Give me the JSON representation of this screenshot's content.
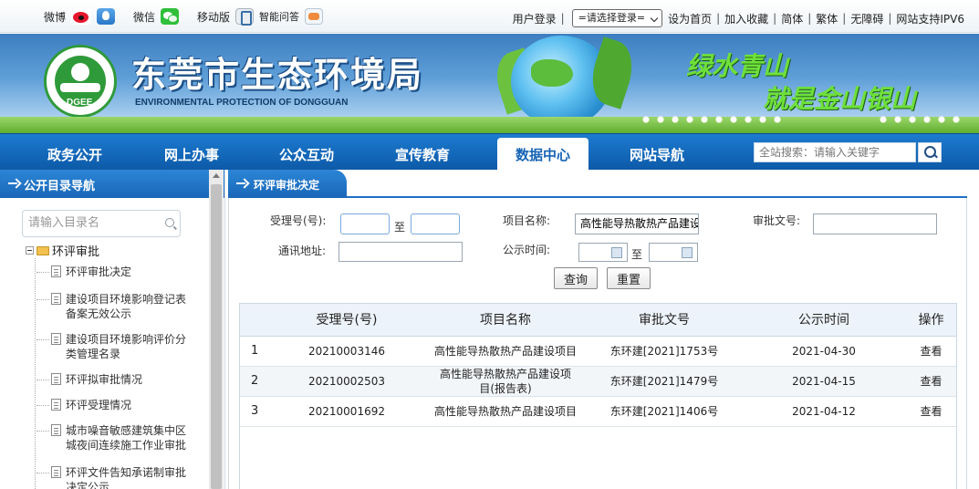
{
  "topbar": {
    "weibo_label": "微博",
    "wechat_label": "微信",
    "mobile_label": "移动版",
    "qa_label": "智能问答",
    "user_login": "用户登录",
    "login_select": "=请选择登录=",
    "links": [
      "设为首页",
      "加入收藏",
      "简体",
      "繁体",
      "无障碍",
      "网站支持IPV6"
    ]
  },
  "banner": {
    "logo_text": "DGEE",
    "title": "东莞市生态环境局",
    "subtitle": "ENVIRONMENTAL PROTECTION OF DONGGUAN",
    "slogan_line1": "绿水青山",
    "slogan_line2": "就是金山银山"
  },
  "nav": {
    "items": [
      "政务公开",
      "网上办事",
      "公众互动",
      "宣传教育",
      "数据中心",
      "网站导航"
    ],
    "active": "数据中心",
    "search_placeholder": "全站搜索：请输入关键字"
  },
  "sidebar": {
    "header": "公开目录导航",
    "filter_placeholder": "请输入目录名",
    "root": "环评审批",
    "items": [
      "环评审批决定",
      "建设项目环境影响登记表备案无效公示",
      "建设项目环境影响评价分类管理名录",
      "环评拟审批情况",
      "环评受理情况",
      "城市噪音敏感建筑集中区城夜间连续施工作业审批",
      "环评文件告知承诺制审批决定公示"
    ]
  },
  "main": {
    "tab": "环评审批决定",
    "form": {
      "accept_no_label": "受理号(号):",
      "to_label": "至",
      "project_label": "项目名称:",
      "project_value": "高性能导热散热产品建设项目",
      "approval_no_label": "审批文号:",
      "address_label": "通讯地址:",
      "publish_time_label": "公示时间:",
      "query_button": "查询",
      "reset_button": "重置"
    },
    "table": {
      "headers": [
        "",
        "受理号(号)",
        "项目名称",
        "审批文号",
        "公示时间",
        "操作"
      ],
      "rows": [
        {
          "idx": "1",
          "accept_no": "20210003146",
          "project": "高性能导热散热产品建设项目",
          "approval_no": "东环建[2021]1753号",
          "date": "2021-04-30",
          "op": "查看"
        },
        {
          "idx": "2",
          "accept_no": "20210002503",
          "project": "高性能导热散热产品建设项目(报告表)",
          "approval_no": "东环建[2021]1479号",
          "date": "2021-04-15",
          "op": "查看"
        },
        {
          "idx": "3",
          "accept_no": "20210001692",
          "project": "高性能导热散热产品建设项目",
          "approval_no": "东环建[2021]1406号",
          "date": "2021-04-12",
          "op": "查看"
        }
      ]
    }
  }
}
